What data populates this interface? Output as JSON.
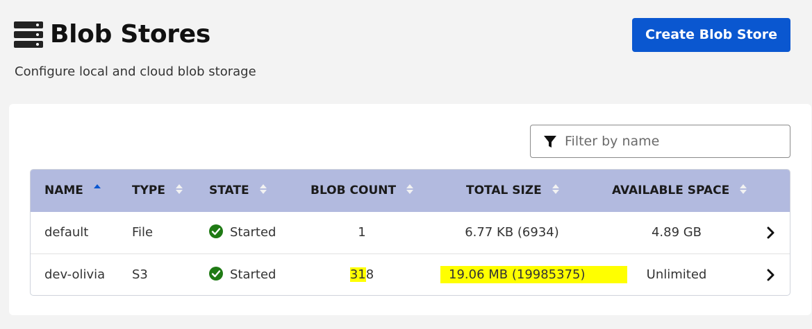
{
  "header": {
    "icon": "database-stack-icon",
    "title": "Blob Stores",
    "subtitle": "Configure local and cloud blob storage",
    "create_button_label": "Create Blob Store",
    "create_button_color": "#0a57d0"
  },
  "filter": {
    "icon": "filter-icon",
    "placeholder": "Filter by name",
    "value": ""
  },
  "table": {
    "header_color": "#b2badf",
    "columns": [
      "NAME",
      "TYPE",
      "STATE",
      "BLOB COUNT",
      "TOTAL SIZE",
      "AVAILABLE SPACE"
    ],
    "sorted_column": "NAME",
    "sort_direction": "ascending",
    "rows": [
      {
        "name": "default",
        "type": "File",
        "state": "Started",
        "state_icon": "check-circle-icon",
        "blob_count": "1",
        "total_size": "6.77 KB (6934)",
        "available_space": "4.89 GB"
      },
      {
        "name": "dev-olivia",
        "type": "S3",
        "state": "Started",
        "state_icon": "check-circle-icon",
        "blob_count": "318",
        "blob_count_highlighted": "31",
        "blob_count_rest": "8",
        "total_size": "19.06 MB (19985375)",
        "available_space": "Unlimited"
      }
    ],
    "status_color": "#1f7a14",
    "highlight_color": "#ffff00"
  }
}
